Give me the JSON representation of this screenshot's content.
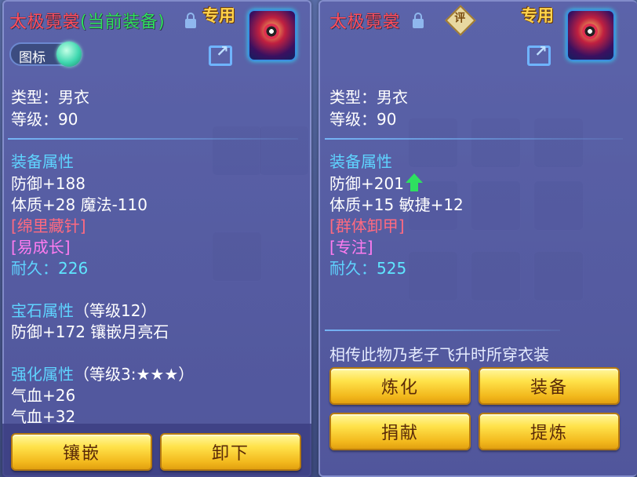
{
  "left": {
    "title_name": "太极霓裳",
    "title_tag": "(当前装备)",
    "special_label": "专用",
    "icon_toggle_label": "图标",
    "type_line": "类型：男衣",
    "level_line": "等级：90",
    "equip_attr_header": "装备属性",
    "defense": "防御+188",
    "stats": "体质+28 魔法-110",
    "effect1": "[绵里藏针]",
    "effect2": "[易成长]",
    "durability_label": "耐久：",
    "durability_value": "226",
    "gem_header": "宝石属性",
    "gem_level": "（等级12）",
    "gem_line": "防御+172 镶嵌月亮石",
    "enhance_header": "强化属性",
    "enhance_level": "（等级3:★★★）",
    "enhance1": "气血+26",
    "enhance2": "气血+32",
    "btn_inlay": "镶嵌",
    "btn_unequip": "卸下"
  },
  "right": {
    "title_name": "太极霓裳",
    "special_label": "专用",
    "rate_label": "评",
    "type_line": "类型：男衣",
    "level_line": "等级：90",
    "equip_attr_header": "装备属性",
    "defense": "防御+201",
    "stats": "体质+15 敏捷+12",
    "effect1": "[群体卸甲]",
    "effect2": "[专注]",
    "durability_label": "耐久：",
    "durability_value": "525",
    "description": "相传此物乃老子飞升时所穿衣装",
    "btn_refine": "炼化",
    "btn_equip": "装备",
    "btn_donate": "捐献",
    "btn_extract": "提炼"
  },
  "colors": {
    "title_red": "#ff5060",
    "tag_green": "#2fe060",
    "section_blue": "#5fd4ff",
    "effect_red": "#ff6a80",
    "effect_magenta": "#ff7cf0",
    "button_gold": "#ffe24a"
  },
  "icons": [
    "lock-icon",
    "share-icon",
    "rate-icon",
    "up-arrow-icon",
    "item-icon"
  ]
}
